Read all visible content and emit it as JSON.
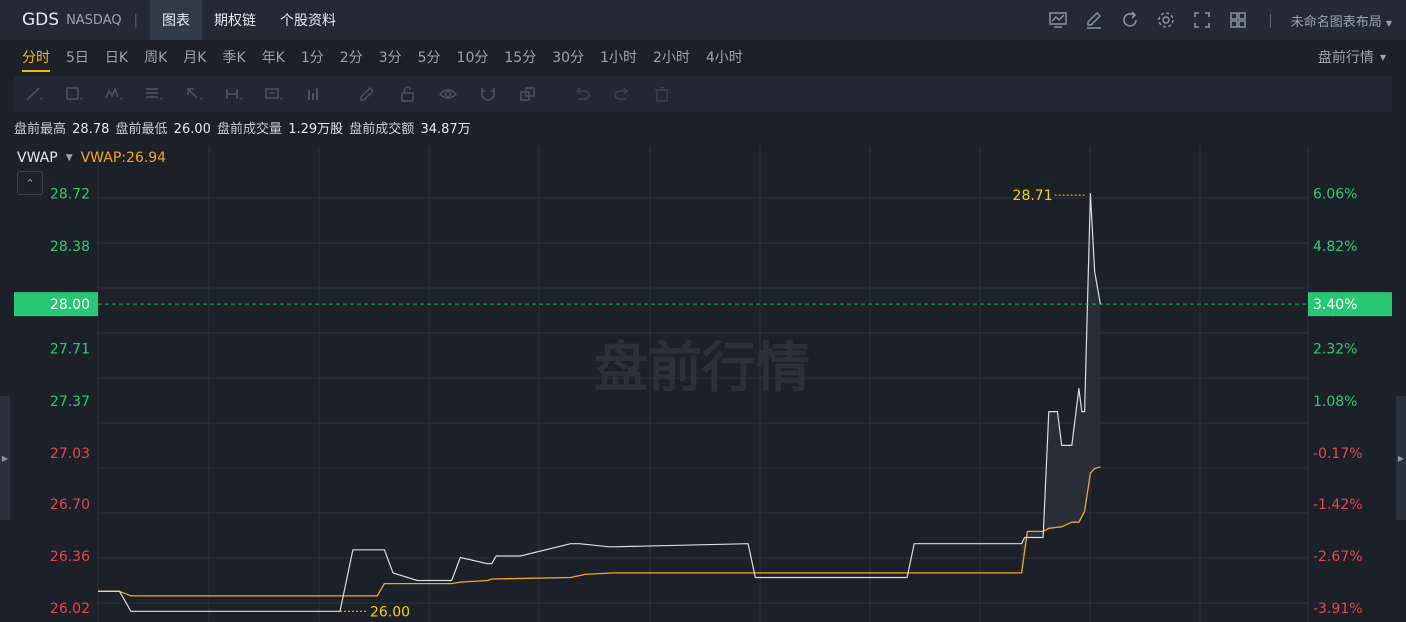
{
  "header": {
    "ticker": "GDS",
    "exchange": "NASDAQ",
    "separator": "|",
    "tabs": [
      {
        "label": "图表",
        "active": true
      },
      {
        "label": "期权链",
        "active": false
      },
      {
        "label": "个股资料",
        "active": false
      }
    ],
    "icons": [
      "monitor-chart-icon",
      "edit-icon",
      "refresh-icon",
      "settings-icon",
      "fullscreen-icon",
      "grid-layout-icon"
    ],
    "layout_separator": "|",
    "layout_name": "未命名图表布局"
  },
  "periods": {
    "items": [
      "分时",
      "5日",
      "日K",
      "周K",
      "月K",
      "季K",
      "年K",
      "1分",
      "2分",
      "3分",
      "5分",
      "10分",
      "15分",
      "30分",
      "1小时",
      "2小时",
      "4小时"
    ],
    "active": "分时",
    "mode_label": "盘前行情"
  },
  "drawing_tools": [
    "trend-line-icon",
    "rectangle-icon",
    "pattern-icon",
    "fibonacci-icon",
    "arrow-icon",
    "measure-icon",
    "text-label-icon",
    "bar-indicator-icon",
    "pencil-icon",
    "lock-icon",
    "eye-icon",
    "magnet-icon",
    "layers-icon",
    "undo-icon",
    "redo-icon",
    "trash-icon"
  ],
  "stats": {
    "high_label": "盘前最高",
    "high_value": "28.78",
    "low_label": "盘前最低",
    "low_value": "26.00",
    "volume_label": "盘前成交量",
    "volume_value": "1.29万股",
    "amount_label": "盘前成交额",
    "amount_value": "34.87万"
  },
  "indicator": {
    "name": "VWAP",
    "value_text": "VWAP:26.94",
    "collapse_glyph": "⌃"
  },
  "watermark": "盘前行情",
  "colors": {
    "background": "#1b2029",
    "grid": "#2b323c",
    "price_line": "#d8dde4",
    "vwap_line": "#f5a623",
    "up": "#2ecc71",
    "down": "#e5484d",
    "marker": "#f5d20a",
    "current_tag_bg": "#27c774"
  },
  "chart_data": {
    "type": "line",
    "ylim": [
      25.93,
      29.03
    ],
    "xlim": [
      0,
      100
    ],
    "grid": true,
    "price_ticks": [
      "28.72",
      "28.38",
      "27.71",
      "27.37",
      "27.03",
      "26.70",
      "26.36",
      "26.02"
    ],
    "price_tick_values": [
      28.72,
      28.38,
      27.71,
      27.37,
      27.03,
      26.7,
      26.36,
      26.02
    ],
    "price_tick_colors": [
      "up",
      "up",
      "up",
      "up",
      "down",
      "down",
      "down",
      "down"
    ],
    "pct_ticks": [
      "6.06%",
      "4.82%",
      "2.32%",
      "1.08%",
      "-0.17%",
      "-1.42%",
      "-2.67%",
      "-3.91%"
    ],
    "pct_tick_values": [
      28.72,
      28.38,
      27.71,
      27.37,
      27.03,
      26.7,
      26.36,
      26.02
    ],
    "pct_tick_colors": [
      "up",
      "up",
      "up",
      "up",
      "down",
      "down",
      "down",
      "down"
    ],
    "current_price": {
      "value": 28.0,
      "label": "28.00",
      "pct_label": "3.40%"
    },
    "high_marker": {
      "x": 68.9,
      "value": 28.71,
      "label": "28.71"
    },
    "low_marker": {
      "x": 16.9,
      "value": 26.0,
      "label": "26.00"
    },
    "series": [
      {
        "name": "price",
        "color_key": "price_line",
        "x": [
          0,
          1.5,
          2.3,
          3,
          16.9,
          17.8,
          20,
          20.6,
          22.3,
          24.7,
          25.3,
          27.2,
          27.5,
          27.8,
          29.5,
          33,
          33.6,
          35.7,
          36,
          45.4,
          45.9,
          56.5,
          57,
          64.5,
          64.7,
          66,
          66.4,
          67,
          67.3,
          68,
          68.5,
          68.7,
          68.9,
          69.3,
          69.6,
          70
        ],
        "y": [
          26.13,
          26.13,
          26.0,
          26.0,
          26.0,
          26.4,
          26.4,
          26.25,
          26.2,
          26.2,
          26.35,
          26.31,
          26.31,
          26.36,
          26.36,
          26.44,
          26.44,
          26.42,
          26.42,
          26.44,
          26.22,
          26.22,
          26.44,
          26.44,
          26.48,
          26.48,
          27.3,
          27.3,
          27.08,
          27.08,
          27.45,
          27.3,
          27.3,
          28.72,
          28.21,
          28.0
        ]
      },
      {
        "name": "VWAP",
        "color_key": "vwap_line",
        "x": [
          0,
          1.5,
          2.3,
          16.9,
          17.8,
          19.5,
          20,
          24.7,
          25.3,
          27.2,
          27.5,
          33,
          34,
          36,
          45.4,
          56.5,
          64.5,
          64.9,
          66,
          66.4,
          67.3,
          68,
          68.5,
          68.9,
          69.3,
          69.6,
          70
        ],
        "y": [
          26.13,
          26.13,
          26.1,
          26.1,
          26.1,
          26.1,
          26.18,
          26.18,
          26.19,
          26.2,
          26.21,
          26.22,
          26.24,
          26.25,
          26.25,
          26.25,
          26.25,
          26.52,
          26.52,
          26.54,
          26.55,
          26.58,
          26.58,
          26.65,
          26.9,
          26.93,
          26.94
        ]
      }
    ]
  }
}
